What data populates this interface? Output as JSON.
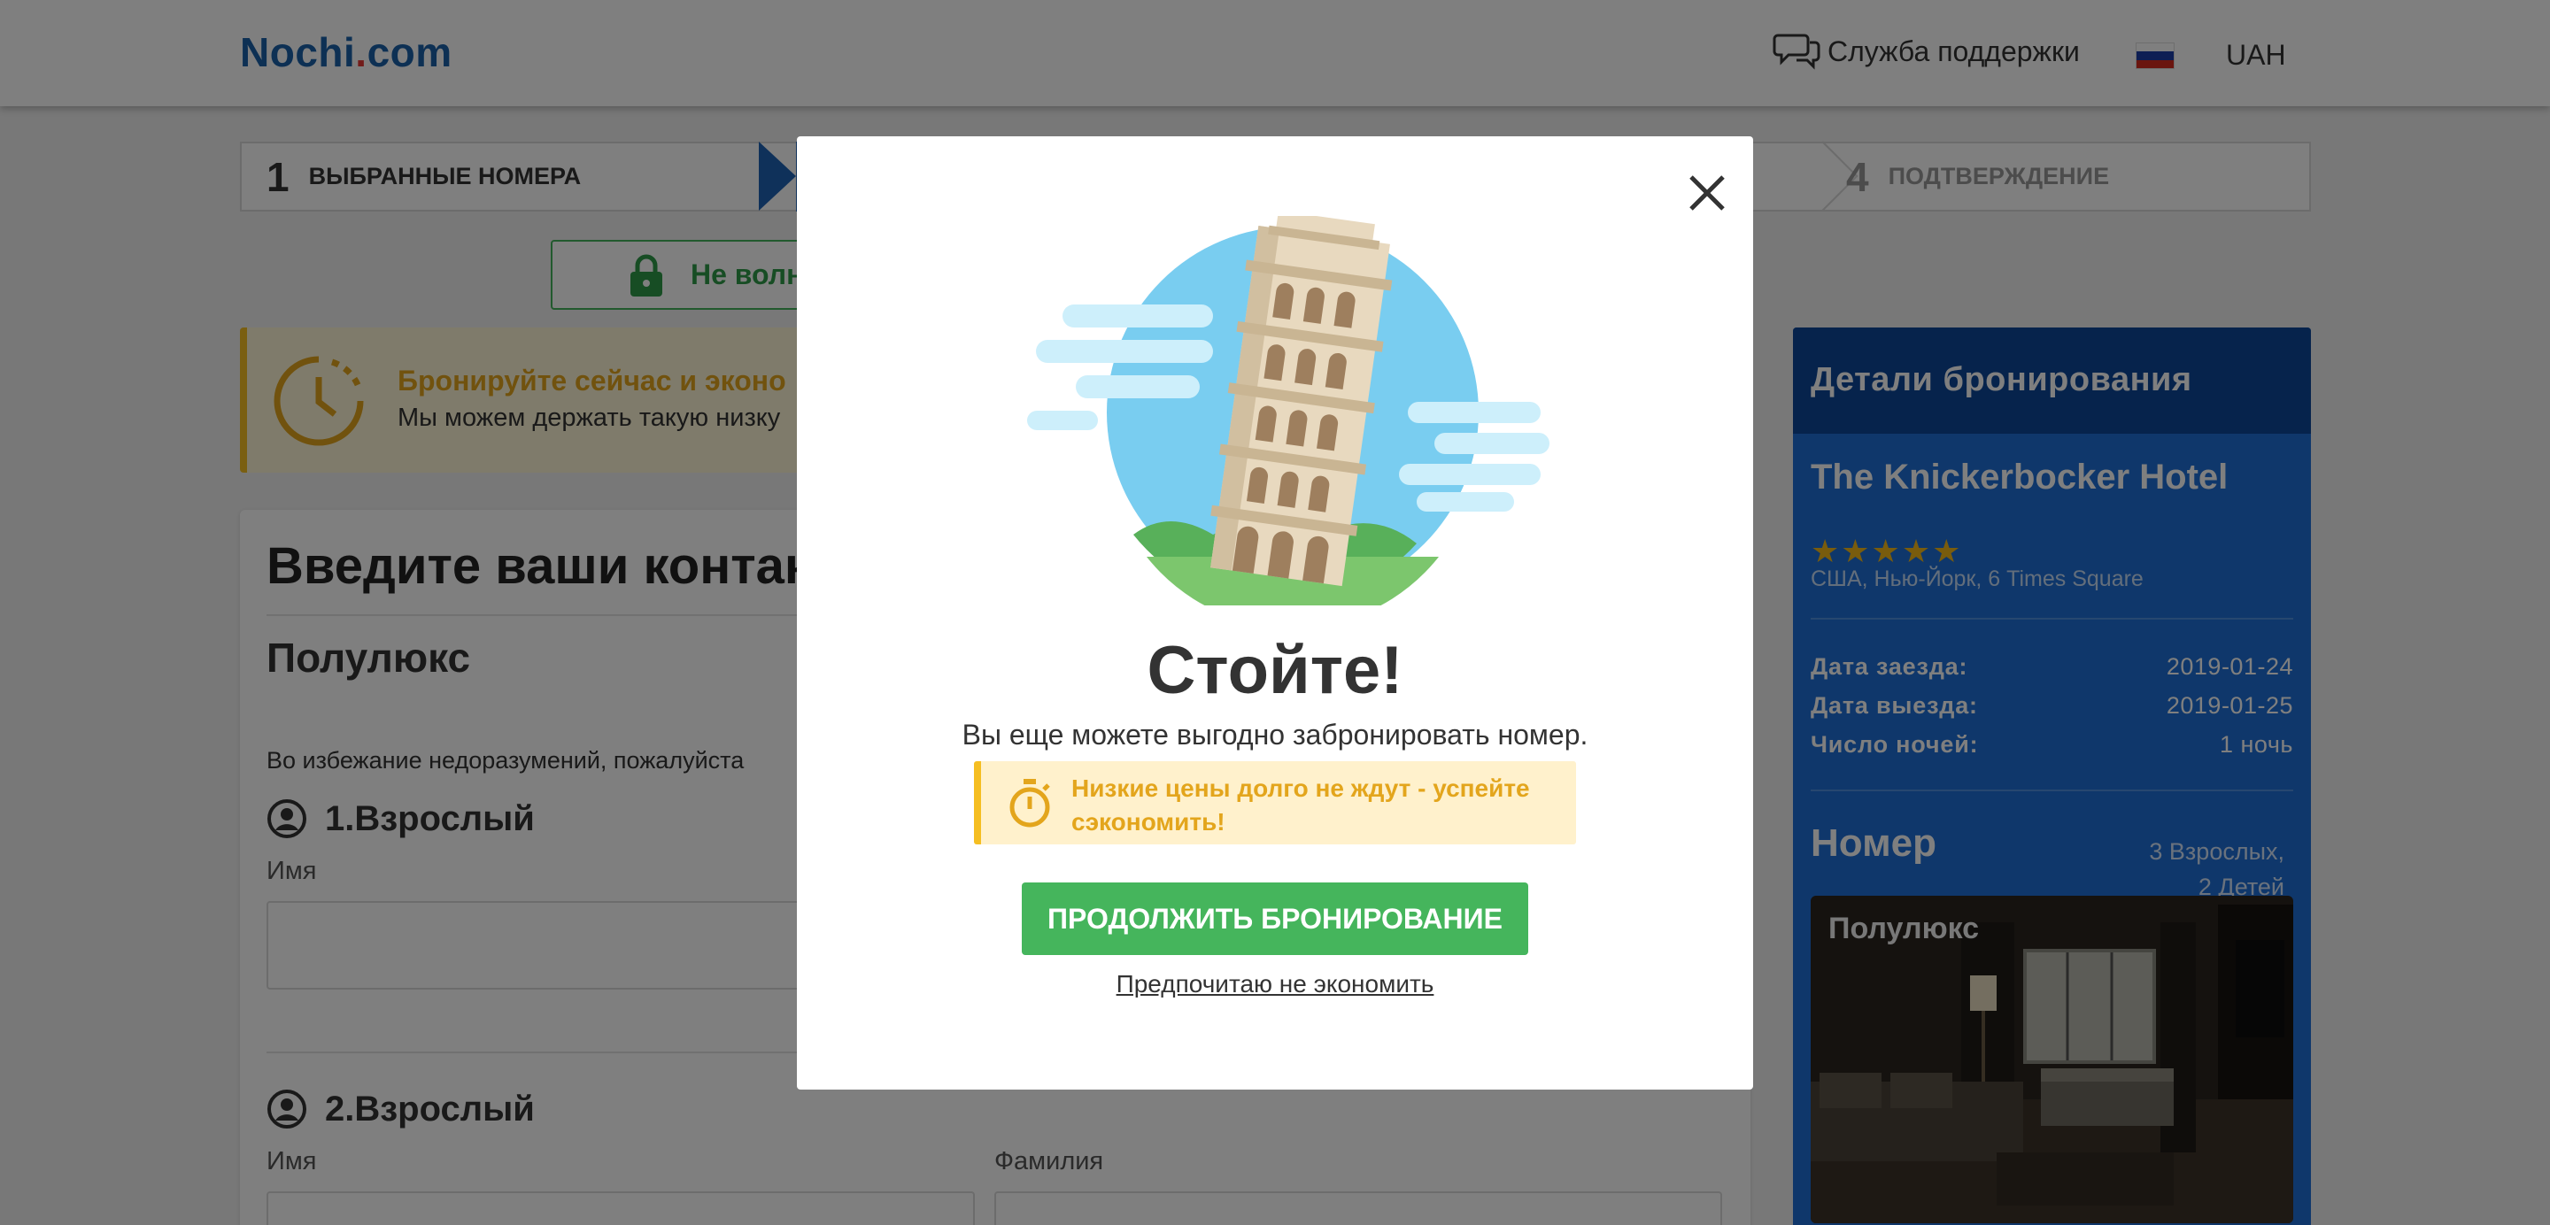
{
  "header": {
    "logo_main": "Nochi",
    "logo_dot": ".",
    "logo_tld": "com",
    "support_label": "Служба поддержки",
    "currency": "UAH"
  },
  "steps": [
    {
      "num": "1",
      "label": "Выбранные номера",
      "state": "done"
    },
    {
      "num": "4",
      "label": "Подтверждение",
      "state": "pending"
    }
  ],
  "secure_badge": {
    "text": "Не волну"
  },
  "promo": {
    "title": "Бронируйте сейчас и эконо",
    "text": "Мы можем держать такую низку"
  },
  "form": {
    "title": "Введите ваши контак",
    "room_name": "Полулюкс",
    "note": "Во избежание недоразумений, пожалуйста",
    "guests": [
      {
        "label": "1.Взрослый",
        "first_name_label": "Имя"
      },
      {
        "label": "2.Взрослый",
        "first_name_label": "Имя",
        "last_name_label": "Фамилия"
      }
    ]
  },
  "sidebar": {
    "title": "Детали бронирования",
    "hotel_name": "The Knickerbocker Hotel",
    "stars": "★★★★★",
    "address": "США, Нью-Йорк, 6 Times Square",
    "details": [
      {
        "key": "Дата заезда:",
        "value": "2019-01-24"
      },
      {
        "key": "Дата выезда:",
        "value": "2019-01-25"
      },
      {
        "key": "Число ночей:",
        "value": "1 ночь"
      }
    ],
    "room_title": "Номер",
    "occupancy_line1": "3 Взрослых,",
    "occupancy_line2": "2 Детей",
    "photo_label": "Полулюкс"
  },
  "modal": {
    "title": "Стойте!",
    "subtitle": "Вы еще можете выгодно забронировать номер.",
    "warning": "Низкие цены долго не ждут - успейте сэкономить!",
    "continue_button": "Продолжить бронирование",
    "decline_link": "Предпочитаю не экономить"
  },
  "colors": {
    "brand_blue": "#1b61a8",
    "accent_green": "#45b55c",
    "warning_yellow": "#f5be22",
    "sidebar_blue": "#1e6fd6",
    "sidebar_head": "#0d4799",
    "flag": [
      "#ffffff",
      "#1c3fa8",
      "#d52b1e"
    ]
  },
  "icons": {
    "support": "chat-bubbles-icon",
    "lock": "lock-icon",
    "clock": "clock-icon",
    "stopwatch": "stopwatch-icon",
    "close": "close-icon",
    "user": "user-circle-icon"
  }
}
